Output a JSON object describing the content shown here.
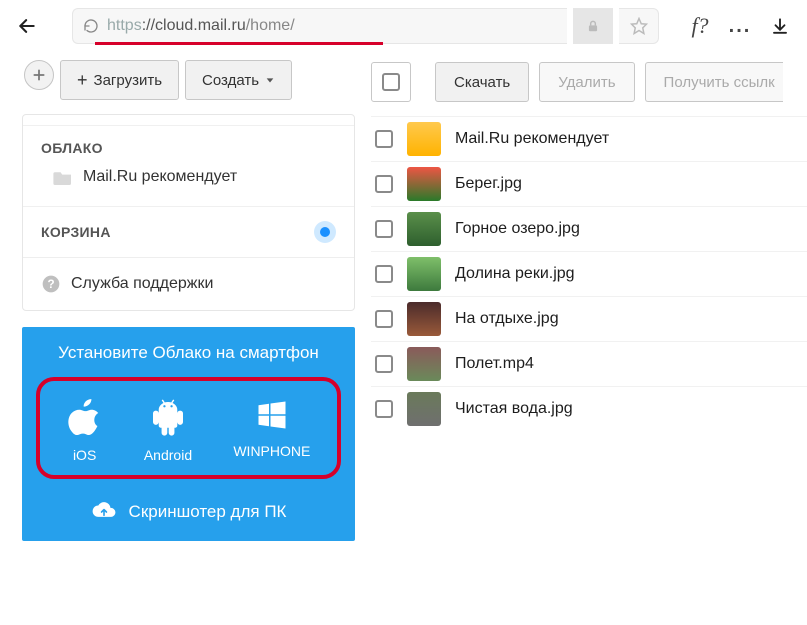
{
  "browser": {
    "url_protocol": "https",
    "url_domain": "://cloud.mail.ru",
    "url_path": "/home/",
    "fq_label": "f?",
    "ellipsis": "..."
  },
  "left": {
    "upload": "Загрузить",
    "create": "Создать",
    "cloud_header": "ОБЛАКО",
    "cloud_item": "Mail.Ru рекомендует",
    "trash_header": "КОРЗИНА",
    "support": "Служба поддержки"
  },
  "promo": {
    "title": "Установите Облако на смартфон",
    "ios": "iOS",
    "android": "Android",
    "winphone": "WINPHONE",
    "screenshoter": "Скриншотер для ПК"
  },
  "toolbar": {
    "download": "Скачать",
    "delete": "Удалить",
    "get_link": "Получить ссылк"
  },
  "files": [
    {
      "name": "Mail.Ru рекомендует",
      "thumb": "folder"
    },
    {
      "name": "Берег.jpg",
      "thumb": "t1"
    },
    {
      "name": "Горное озеро.jpg",
      "thumb": "t2"
    },
    {
      "name": "Долина реки.jpg",
      "thumb": "t3"
    },
    {
      "name": "На отдыхе.jpg",
      "thumb": "t4"
    },
    {
      "name": "Полет.mp4",
      "thumb": "t5"
    },
    {
      "name": "Чистая вода.jpg",
      "thumb": "t6"
    }
  ]
}
